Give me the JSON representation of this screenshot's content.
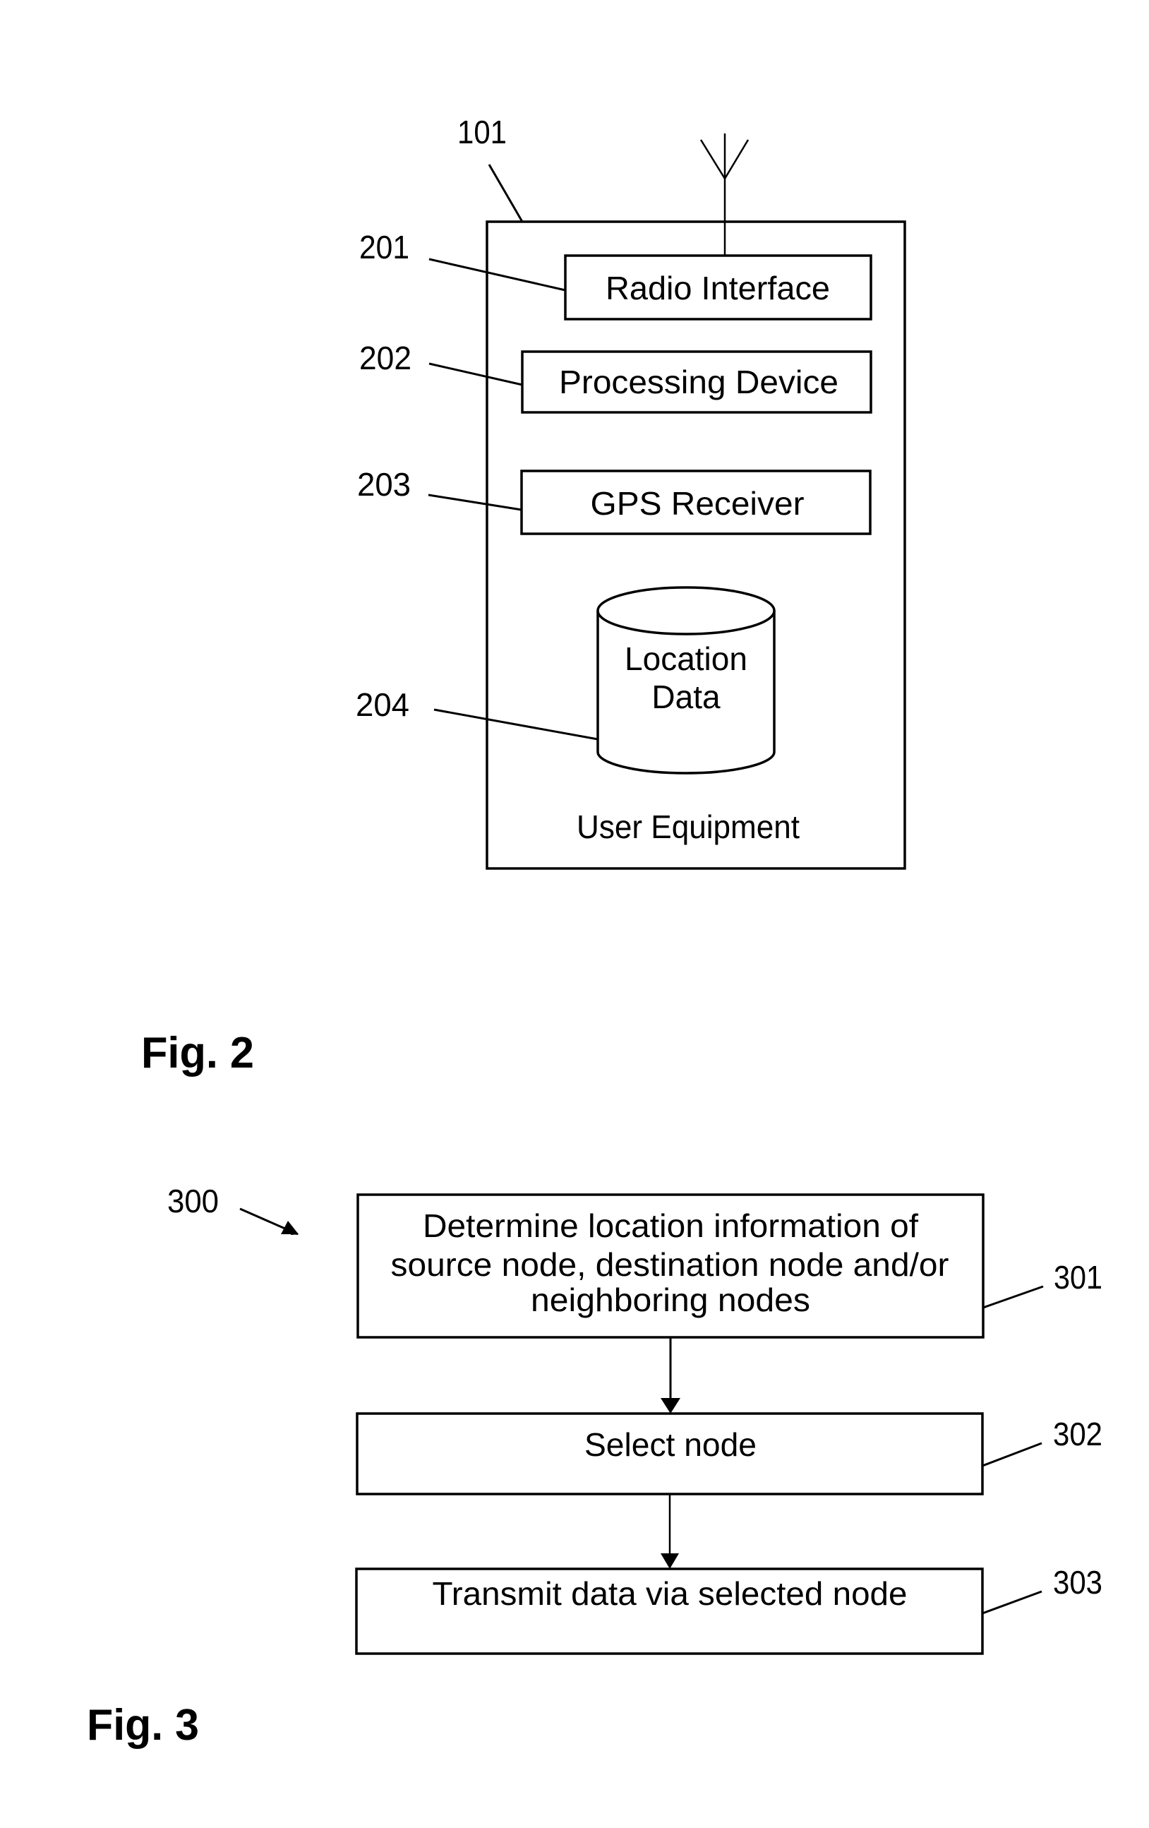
{
  "figure2": {
    "caption": "Fig. 2",
    "device": {
      "ref": "101",
      "label": "User Equipment",
      "antenna_icon": "antenna-icon"
    },
    "components": [
      {
        "ref": "201",
        "label": "Radio Interface"
      },
      {
        "ref": "202",
        "label": "Processing Device"
      },
      {
        "ref": "203",
        "label": "GPS Receiver"
      },
      {
        "ref": "204",
        "label_lines": [
          "Location",
          "Data"
        ],
        "shape": "database-cylinder"
      }
    ]
  },
  "figure3": {
    "caption": "Fig. 3",
    "method_ref": "300",
    "steps": [
      {
        "ref": "301",
        "lines": [
          "Determine location information of",
          "source node, destination node and/or",
          "neighboring nodes"
        ]
      },
      {
        "ref": "302",
        "lines": [
          "Select node"
        ]
      },
      {
        "ref": "303",
        "lines": [
          "Transmit data via selected node"
        ]
      }
    ]
  }
}
